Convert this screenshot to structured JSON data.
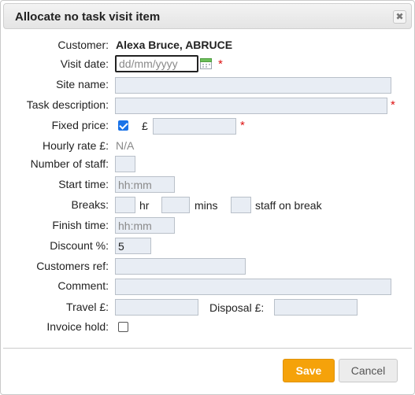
{
  "dialog": {
    "title": "Allocate no task visit item",
    "close_glyph": "✖"
  },
  "form": {
    "customer": {
      "label": "Customer:",
      "value": "Alexa Bruce, ABRUCE"
    },
    "visit_date": {
      "label": "Visit date:",
      "placeholder": "dd/mm/yyyy",
      "required_mark": "*"
    },
    "site_name": {
      "label": "Site name:",
      "value": ""
    },
    "task_description": {
      "label": "Task description:",
      "value": "",
      "required_mark": "*"
    },
    "fixed_price": {
      "label": "Fixed price:",
      "checked": true,
      "currency": "£",
      "value": "",
      "required_mark": "*"
    },
    "hourly_rate": {
      "label": "Hourly rate £:",
      "value": "N/A"
    },
    "number_of_staff": {
      "label": "Number of staff:",
      "value": ""
    },
    "start_time": {
      "label": "Start time:",
      "placeholder": "hh:mm"
    },
    "breaks": {
      "label": "Breaks:",
      "hr_label": "hr",
      "mins_label": "mins",
      "staff_label": "staff on break"
    },
    "finish_time": {
      "label": "Finish time:",
      "placeholder": "hh:mm"
    },
    "discount": {
      "label": "Discount %:",
      "value": "5"
    },
    "customers_ref": {
      "label": "Customers ref:",
      "value": ""
    },
    "comment": {
      "label": "Comment:",
      "value": ""
    },
    "travel": {
      "label": "Travel £:",
      "value": ""
    },
    "disposal": {
      "label": "Disposal £:",
      "value": ""
    },
    "invoice_hold": {
      "label": "Invoice hold:",
      "checked": false
    }
  },
  "buttons": {
    "save": "Save",
    "cancel": "Cancel"
  },
  "colors": {
    "save_button": "#f5a20a",
    "required": "#dd1111",
    "input_background": "#e8edf4",
    "checkbox_checked": "#1a73e8"
  },
  "icons": {
    "calendar": "calendar-icon",
    "close": "close-icon"
  }
}
